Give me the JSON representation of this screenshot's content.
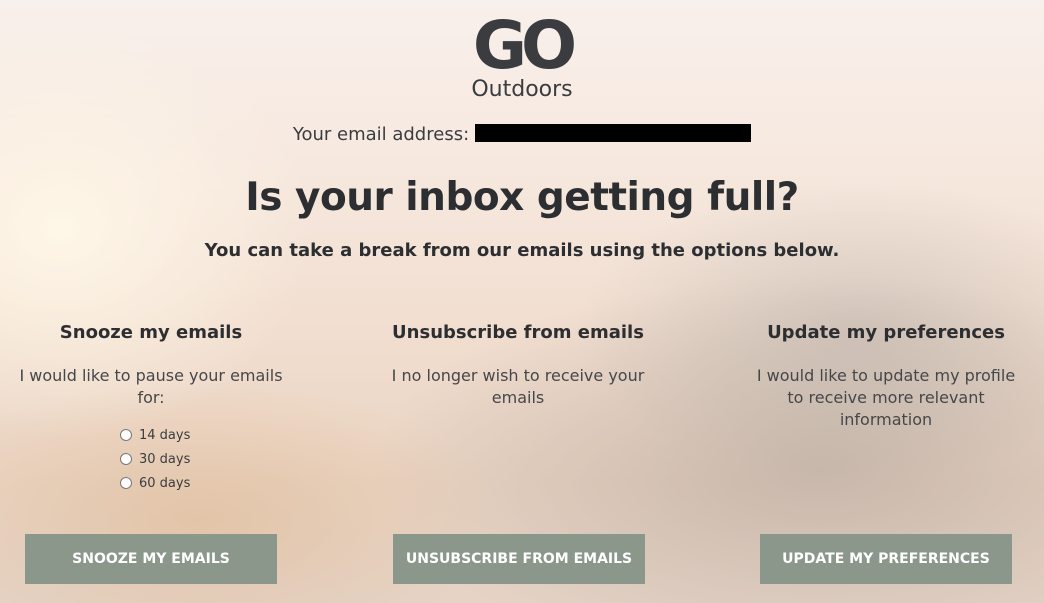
{
  "logo": {
    "main": "GO",
    "sub": "Outdoors"
  },
  "email": {
    "label": "Your email address:"
  },
  "headline": "Is your inbox getting full?",
  "subheadline": "You can take a break from our emails using the options below.",
  "options": [
    {
      "title": "Snooze my emails",
      "description": "I would like to pause your emails for:",
      "choices": [
        "14 days",
        "30 days",
        "60 days"
      ],
      "button": "SNOOZE MY EMAILS"
    },
    {
      "title": "Unsubscribe from emails",
      "description": "I no longer wish to receive your emails",
      "button": "UNSUBSCRIBE FROM EMAILS"
    },
    {
      "title": "Update my preferences",
      "description": "I would like to update my profile to receive more relevant information",
      "button": "UPDATE MY PREFERENCES"
    }
  ],
  "colors": {
    "button": "#8c978b",
    "text": "#2c2e31"
  }
}
